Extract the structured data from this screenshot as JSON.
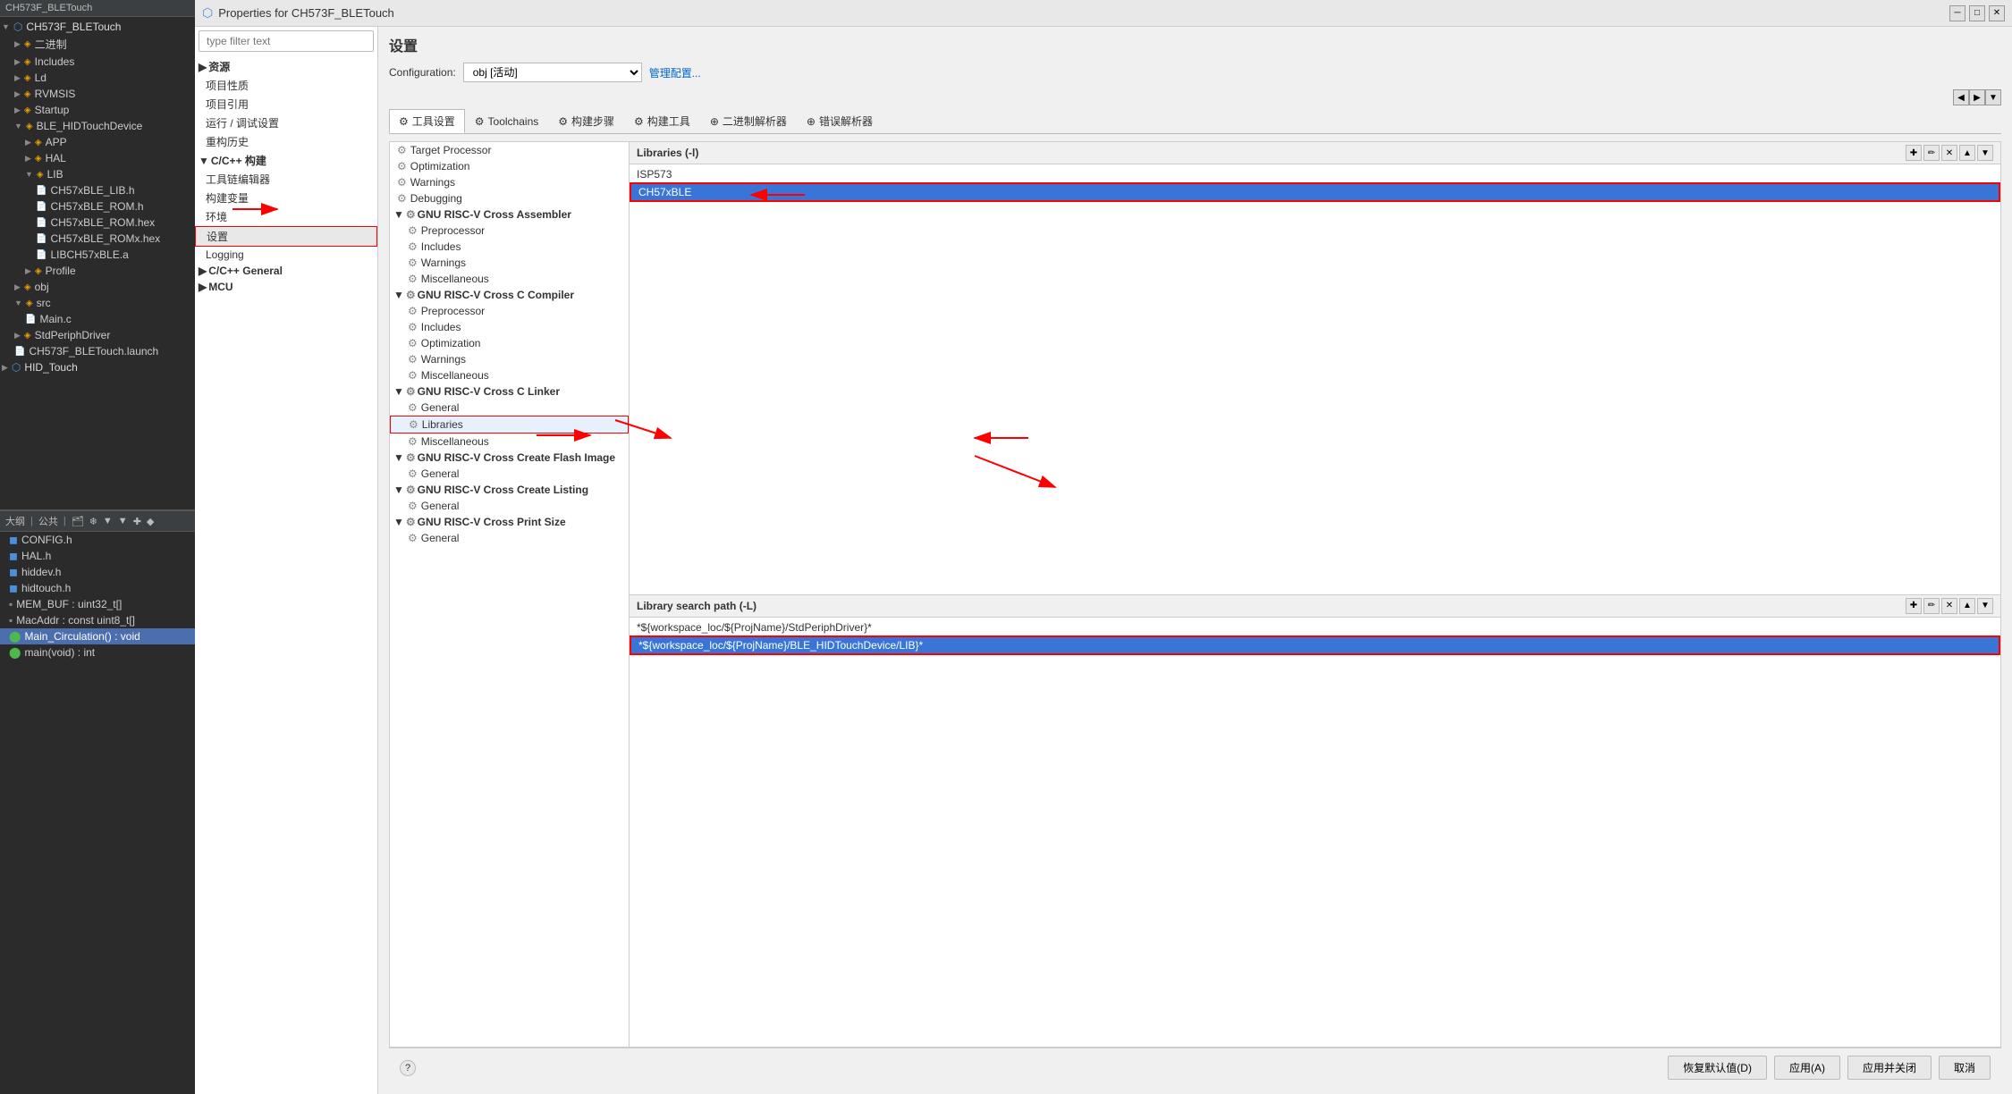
{
  "ide": {
    "project_name": "CH573F_BLETouch",
    "tree_items": [
      {
        "label": "CH573F_BLETouch",
        "level": 0,
        "type": "project",
        "icon": "▼"
      },
      {
        "label": "二进制",
        "level": 1,
        "type": "folder",
        "icon": "▶"
      },
      {
        "label": "Includes",
        "level": 1,
        "type": "folder",
        "icon": "▶"
      },
      {
        "label": "Ld",
        "level": 1,
        "type": "folder",
        "icon": "▶"
      },
      {
        "label": "RVMSIS",
        "level": 1,
        "type": "folder",
        "icon": "▶"
      },
      {
        "label": "Startup",
        "level": 1,
        "type": "folder",
        "icon": "▶"
      },
      {
        "label": "BLE_HIDTouchDevice",
        "level": 1,
        "type": "folder-open",
        "icon": "▼"
      },
      {
        "label": "APP",
        "level": 2,
        "type": "folder",
        "icon": "▶"
      },
      {
        "label": "HAL",
        "level": 2,
        "type": "folder",
        "icon": "▶"
      },
      {
        "label": "LIB",
        "level": 2,
        "type": "folder-open",
        "icon": "▼"
      },
      {
        "label": "CH57xBLE_LIB.h",
        "level": 3,
        "type": "file-h"
      },
      {
        "label": "CH57xBLE_ROM.h",
        "level": 3,
        "type": "file-h"
      },
      {
        "label": "CH57xBLE_ROM.hex",
        "level": 3,
        "type": "file"
      },
      {
        "label": "CH57xBLE_ROMx.hex",
        "level": 3,
        "type": "file"
      },
      {
        "label": "LIBCH57xBLE.a",
        "level": 3,
        "type": "file"
      },
      {
        "label": "Profile",
        "level": 2,
        "type": "folder",
        "icon": "▶"
      },
      {
        "label": "obj",
        "level": 1,
        "type": "folder",
        "icon": "▶"
      },
      {
        "label": "src",
        "level": 1,
        "type": "folder-open",
        "icon": "▼"
      },
      {
        "label": "Main.c",
        "level": 2,
        "type": "file-c"
      },
      {
        "label": "StdPeriphDriver",
        "level": 1,
        "type": "folder",
        "icon": "▶"
      },
      {
        "label": "CH573F_BLETouch.launch",
        "level": 1,
        "type": "file"
      },
      {
        "label": "HID_Touch",
        "level": 0,
        "type": "project",
        "icon": "▶"
      }
    ]
  },
  "outline": {
    "header_items": [
      "大纲",
      "公共",
      "日",
      "冷",
      "▼",
      "▼",
      "✚",
      "◆"
    ],
    "items": [
      {
        "label": "CONFIG.h",
        "type": "file-h"
      },
      {
        "label": "HAL.h",
        "type": "file-h"
      },
      {
        "label": "hiddev.h",
        "type": "file-h"
      },
      {
        "label": "hidtouch.h",
        "type": "file-h"
      },
      {
        "label": "MEM_BUF : uint32_t[]",
        "type": "var"
      },
      {
        "label": "MacAddr : const uint8_t[]",
        "type": "var"
      },
      {
        "label": "Main_Circulation() : void",
        "type": "func",
        "highlight": true
      },
      {
        "label": "main(void) : int",
        "type": "func"
      }
    ]
  },
  "dialog": {
    "title": "Properties for CH573F_BLETouch",
    "filter_placeholder": "type filter text",
    "settings_label": "设置",
    "configuration_label": "Configuration:",
    "configuration_value": "obj [活动]",
    "manage_label": "管理配置...",
    "tabs": [
      {
        "label": "⚙ 工具设置",
        "active": true
      },
      {
        "label": "⚙ Toolchains"
      },
      {
        "label": "⚙ 构建步骤"
      },
      {
        "label": "⚙ 构建工具"
      },
      {
        "label": "⊕ 二进制解析器"
      },
      {
        "label": "⊕ 错误解析器"
      }
    ],
    "filter_tree": [
      {
        "label": "资源",
        "level": 0,
        "type": "group"
      },
      {
        "label": "项目性质",
        "level": 1
      },
      {
        "label": "项目引用",
        "level": 1
      },
      {
        "label": "运行 / 调试设置",
        "level": 1
      },
      {
        "label": "重构历史",
        "level": 1
      },
      {
        "label": "C/C++ 构建",
        "level": 0,
        "type": "group-open"
      },
      {
        "label": "工具链编辑器",
        "level": 1
      },
      {
        "label": "构建变量",
        "level": 1
      },
      {
        "label": "环境",
        "level": 1
      },
      {
        "label": "设置",
        "level": 1,
        "highlight": true
      },
      {
        "label": "Logging",
        "level": 1
      },
      {
        "label": "C/C++ General",
        "level": 0,
        "type": "group"
      },
      {
        "label": "MCU",
        "level": 0,
        "type": "group"
      }
    ],
    "tool_tree": [
      {
        "label": "Target Processor",
        "level": 0
      },
      {
        "label": "Optimization",
        "level": 0
      },
      {
        "label": "Warnings",
        "level": 0
      },
      {
        "label": "Debugging",
        "level": 0
      },
      {
        "label": "GNU RISC-V Cross Assembler",
        "level": 0,
        "type": "group"
      },
      {
        "label": "Preprocessor",
        "level": 1
      },
      {
        "label": "Includes",
        "level": 1
      },
      {
        "label": "Warnings",
        "level": 1
      },
      {
        "label": "Miscellaneous",
        "level": 1
      },
      {
        "label": "GNU RISC-V Cross C Compiler",
        "level": 0,
        "type": "group"
      },
      {
        "label": "Preprocessor",
        "level": 1
      },
      {
        "label": "Includes",
        "level": 1
      },
      {
        "label": "Optimization",
        "level": 1
      },
      {
        "label": "Warnings",
        "level": 1
      },
      {
        "label": "Miscellaneous",
        "level": 1
      },
      {
        "label": "GNU RISC-V Cross C Linker",
        "level": 0,
        "type": "group"
      },
      {
        "label": "General",
        "level": 1
      },
      {
        "label": "Libraries",
        "level": 1,
        "highlight": true
      },
      {
        "label": "Miscellaneous",
        "level": 1
      },
      {
        "label": "GNU RISC-V Cross Create Flash Image",
        "level": 0,
        "type": "group"
      },
      {
        "label": "General",
        "level": 1
      },
      {
        "label": "GNU RISC-V Cross Create Listing",
        "level": 0,
        "type": "group"
      },
      {
        "label": "General",
        "level": 1
      },
      {
        "label": "GNU RISC-V Cross Print Size",
        "level": 0,
        "type": "group"
      },
      {
        "label": "General",
        "level": 1
      }
    ],
    "libraries_header": "Libraries (-l)",
    "library_items": [
      {
        "label": "ISP573",
        "selected": false
      },
      {
        "label": "CH57xBLE",
        "selected": true,
        "highlight": true
      }
    ],
    "library_path_header": "Library search path (-L)",
    "library_path_items": [
      {
        "label": "*${workspace_loc/${ProjName}/StdPeriphDriver}*",
        "selected": false
      },
      {
        "label": "*${workspace_loc/${ProjName}/BLE_HIDTouchDevice/LIB}*",
        "selected": true,
        "highlight": true
      }
    ],
    "action_buttons": [
      {
        "label": "恢复默认值(D)"
      },
      {
        "label": "应用(A)"
      },
      {
        "label": "应用并关闭"
      },
      {
        "label": "取消"
      }
    ],
    "help_label": "?"
  }
}
